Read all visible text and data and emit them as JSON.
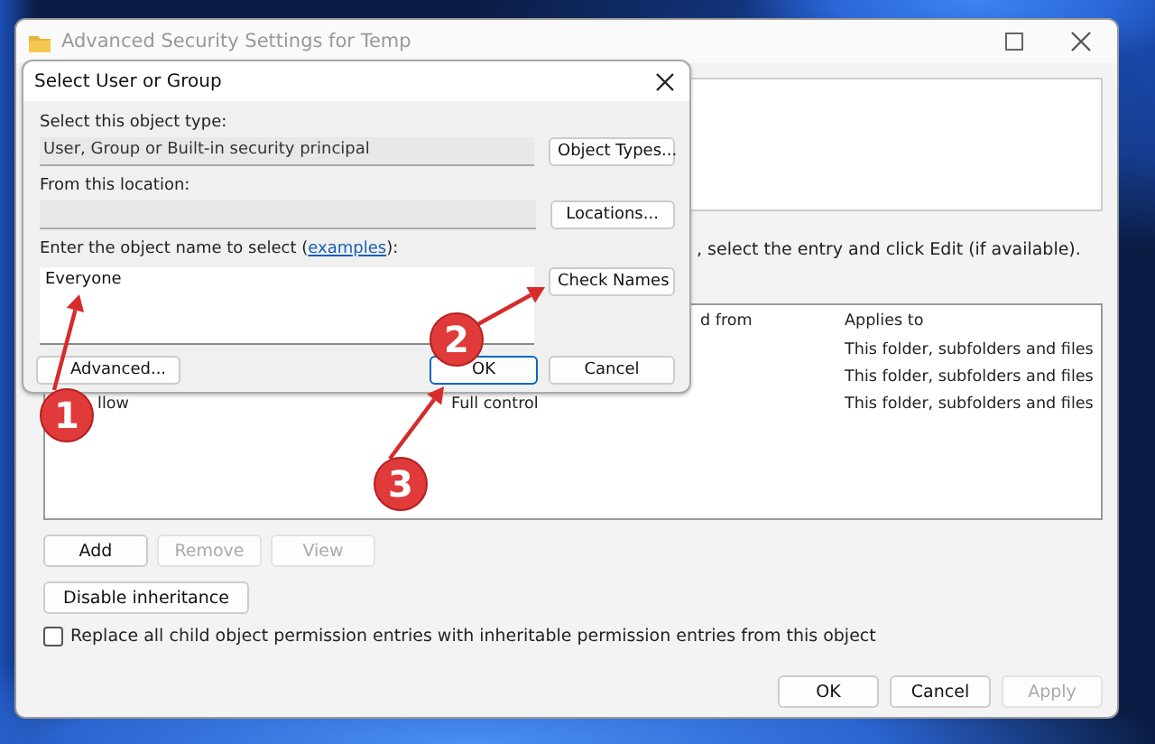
{
  "window": {
    "title": "Advanced Security Settings for Temp",
    "instruction": ", select the entry and click Edit (if available).",
    "table": {
      "columns": [
        "d from",
        "Applies to"
      ],
      "rows": [
        {
          "applies_to": "This folder, subfolders and files"
        },
        {
          "applies_to": "This folder, subfolders and files"
        },
        {
          "column_1": "llow",
          "column_2": "Full control",
          "applies_to": "This folder, subfolders and files"
        }
      ]
    },
    "buttons": [
      {
        "label": "Add",
        "disabled": false
      },
      {
        "label": "Remove",
        "disabled": true
      },
      {
        "label": "View",
        "disabled": true
      }
    ],
    "inheritance_button": "Disable inheritance",
    "replace_option": {
      "label": "Replace all child object permission entries with inheritable permission entries from this object",
      "checked": false
    },
    "footer_buttons": [
      {
        "label": "OK",
        "disabled": false
      },
      {
        "label": "Cancel",
        "disabled": false
      },
      {
        "label": "Apply",
        "disabled": true
      }
    ]
  },
  "dialog": {
    "title": "Select User or Group",
    "object_type_label": "Select this object type:",
    "object_type": "User, Group or Built-in security principal",
    "object_types_button": "Object Types...",
    "location_label": "From this location:",
    "locations_button": "Locations...",
    "name_label": "Enter the object name to select (",
    "name_label_link": "examples",
    "name_label_end": "):",
    "name_value": "Everyone",
    "check_names_button": "Check Names",
    "advanced_button": "Advanced...",
    "ok_button": "OK",
    "cancel_button": "Cancel"
  },
  "annotations": [
    {
      "number": "1"
    },
    {
      "number": "2"
    },
    {
      "number": "3"
    }
  ]
}
